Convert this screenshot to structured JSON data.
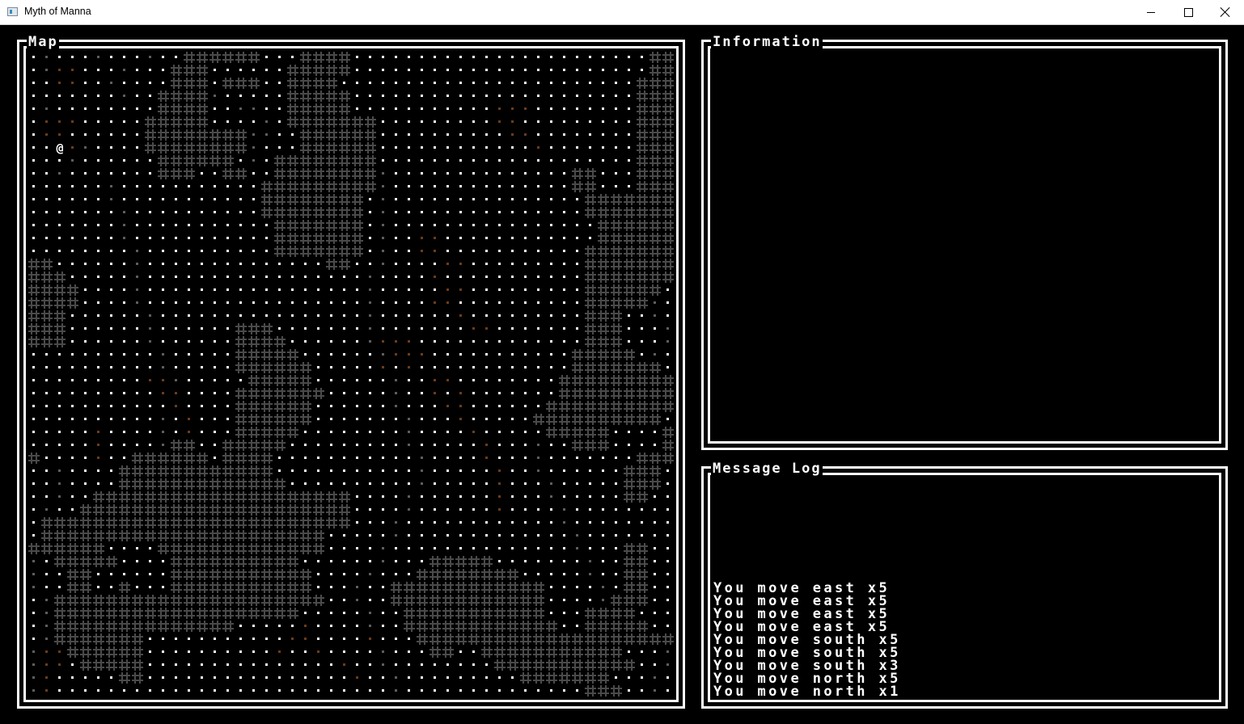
{
  "window": {
    "title": "Myth of Manna",
    "controls": {
      "minimize": "minimize",
      "maximize": "maximize",
      "close": "close"
    }
  },
  "panels": {
    "map_title": "Map",
    "info_title": "Information",
    "log_title": "Message Log"
  },
  "map": {
    "columns": 50,
    "rows": 50,
    "player_glyph": "@",
    "player_position": {
      "col": 2,
      "row": 7
    },
    "legend": {
      "wall": "#",
      "floor_lit": "white",
      "floor_remembered": "gray",
      "floor_dirt": "brown"
    },
    "colors": {
      "wall": "#4a4a4a",
      "floor_lit": "#ffffff",
      "floor_remembered": "#5e5e5e",
      "floor_dirt": "#6b3d1c",
      "player": "#ffffff"
    },
    "wall_runs": [
      [
        [
          12,
          17
        ],
        [
          21,
          24
        ],
        [
          48,
          49
        ]
      ],
      [
        [
          11,
          13
        ],
        [
          20,
          24
        ],
        [
          48,
          49
        ]
      ],
      [
        [
          11,
          13
        ],
        [
          15,
          17
        ],
        [
          20,
          23
        ],
        [
          47,
          49
        ]
      ],
      [
        [
          10,
          13
        ],
        [
          20,
          24
        ],
        [
          47,
          49
        ]
      ],
      [
        [
          10,
          13
        ],
        [
          20,
          24
        ],
        [
          47,
          49
        ]
      ],
      [
        [
          9,
          13
        ],
        [
          20,
          26
        ],
        [
          47,
          49
        ]
      ],
      [
        [
          9,
          16
        ],
        [
          21,
          26
        ],
        [
          47,
          49
        ]
      ],
      [
        [
          9,
          16
        ],
        [
          21,
          26
        ],
        [
          47,
          49
        ]
      ],
      [
        [
          10,
          15
        ],
        [
          19,
          26
        ],
        [
          47,
          49
        ]
      ],
      [
        [
          10,
          12
        ],
        [
          15,
          16
        ],
        [
          19,
          26
        ],
        [
          42,
          43
        ],
        [
          47,
          49
        ]
      ],
      [
        [
          18,
          26
        ],
        [
          42,
          43
        ],
        [
          47,
          49
        ]
      ],
      [
        [
          18,
          25
        ],
        [
          43,
          49
        ]
      ],
      [
        [
          18,
          25
        ],
        [
          43,
          49
        ]
      ],
      [
        [
          19,
          25
        ],
        [
          44,
          49
        ]
      ],
      [
        [
          19,
          25
        ],
        [
          44,
          49
        ]
      ],
      [
        [
          19,
          25
        ],
        [
          43,
          49
        ]
      ],
      [
        [
          0,
          1
        ],
        [
          23,
          24
        ],
        [
          43,
          49
        ]
      ],
      [
        [
          0,
          2
        ],
        [
          43,
          49
        ]
      ],
      [
        [
          0,
          3
        ],
        [
          43,
          48
        ]
      ],
      [
        [
          0,
          3
        ],
        [
          43,
          47
        ]
      ],
      [
        [
          0,
          2
        ],
        [
          43,
          45
        ]
      ],
      [
        [
          0,
          2
        ],
        [
          16,
          18
        ],
        [
          43,
          45
        ]
      ],
      [
        [
          0,
          2
        ],
        [
          16,
          19
        ],
        [
          43,
          45
        ]
      ],
      [
        [
          16,
          20
        ],
        [
          42,
          46
        ]
      ],
      [
        [
          16,
          21
        ],
        [
          42,
          48
        ]
      ],
      [
        [
          17,
          21
        ],
        [
          41,
          49
        ]
      ],
      [
        [
          16,
          22
        ],
        [
          41,
          49
        ]
      ],
      [
        [
          16,
          21
        ],
        [
          40,
          49
        ]
      ],
      [
        [
          16,
          21
        ],
        [
          39,
          48
        ]
      ],
      [
        [
          16,
          20
        ],
        [
          40,
          44
        ],
        [
          49,
          49
        ]
      ],
      [
        [
          11,
          12
        ],
        [
          15,
          19
        ],
        [
          42,
          44
        ],
        [
          49,
          49
        ]
      ],
      [
        [
          0,
          0
        ],
        [
          8,
          13
        ],
        [
          15,
          18
        ],
        [
          47,
          49
        ]
      ],
      [
        [
          7,
          18
        ],
        [
          46,
          48
        ]
      ],
      [
        [
          7,
          19
        ],
        [
          46,
          48
        ]
      ],
      [
        [
          5,
          24
        ],
        [
          46,
          47
        ]
      ],
      [
        [
          4,
          24
        ]
      ],
      [
        [
          1,
          24
        ]
      ],
      [
        [
          1,
          9
        ],
        [
          10,
          22
        ]
      ],
      [
        [
          0,
          5
        ],
        [
          10,
          22
        ],
        [
          46,
          47
        ]
      ],
      [
        [
          2,
          5
        ],
        [
          6,
          6
        ],
        [
          11,
          20
        ],
        [
          31,
          35
        ],
        [
          46,
          47
        ]
      ],
      [
        [
          3,
          4
        ],
        [
          11,
          21
        ],
        [
          30,
          37
        ],
        [
          46,
          47
        ]
      ],
      [
        [
          3,
          4
        ],
        [
          7,
          7
        ],
        [
          11,
          21
        ],
        [
          28,
          39
        ],
        [
          46,
          47
        ]
      ],
      [
        [
          2,
          22
        ],
        [
          28,
          39
        ],
        [
          45,
          47
        ]
      ],
      [
        [
          2,
          20
        ],
        [
          29,
          39
        ],
        [
          43,
          46
        ]
      ],
      [
        [
          2,
          13
        ],
        [
          14,
          15
        ],
        [
          29,
          40
        ],
        [
          43,
          47
        ]
      ],
      [
        [
          2,
          8
        ],
        [
          30,
          49
        ]
      ],
      [
        [
          3,
          8
        ],
        [
          31,
          32
        ],
        [
          35,
          45
        ]
      ],
      [
        [
          4,
          8
        ],
        [
          36,
          46
        ]
      ],
      [
        [
          7,
          8
        ],
        [
          38,
          40
        ],
        [
          41,
          44
        ]
      ],
      [
        [
          43,
          45
        ]
      ]
    ],
    "dirt_cells": [
      [
        1,
        2
      ],
      [
        1,
        3
      ],
      [
        2,
        2
      ],
      [
        2,
        3
      ],
      [
        5,
        1
      ],
      [
        5,
        2
      ],
      [
        5,
        3
      ],
      [
        6,
        1
      ],
      [
        6,
        2
      ],
      [
        7,
        3
      ],
      [
        4,
        36
      ],
      [
        4,
        37
      ],
      [
        4,
        38
      ],
      [
        5,
        36
      ],
      [
        5,
        37
      ],
      [
        6,
        37
      ],
      [
        6,
        38
      ],
      [
        7,
        39
      ],
      [
        14,
        30
      ],
      [
        14,
        31
      ],
      [
        15,
        30
      ],
      [
        15,
        31
      ],
      [
        16,
        32
      ],
      [
        17,
        31
      ],
      [
        16,
        33
      ],
      [
        18,
        32
      ],
      [
        18,
        33
      ],
      [
        19,
        31
      ],
      [
        19,
        32
      ],
      [
        20,
        33
      ],
      [
        21,
        34
      ],
      [
        21,
        35
      ],
      [
        22,
        27
      ],
      [
        22,
        28
      ],
      [
        22,
        29
      ],
      [
        23,
        28
      ],
      [
        23,
        29
      ],
      [
        23,
        30
      ],
      [
        24,
        27
      ],
      [
        24,
        29
      ],
      [
        25,
        31
      ],
      [
        25,
        32
      ],
      [
        26,
        31
      ],
      [
        26,
        33
      ],
      [
        27,
        32
      ],
      [
        27,
        33
      ],
      [
        28,
        33
      ],
      [
        29,
        34
      ],
      [
        30,
        35
      ],
      [
        31,
        35
      ],
      [
        32,
        36
      ],
      [
        33,
        36
      ],
      [
        34,
        36
      ],
      [
        35,
        36
      ],
      [
        25,
        9
      ],
      [
        25,
        10
      ],
      [
        26,
        10
      ],
      [
        26,
        11
      ],
      [
        27,
        11
      ],
      [
        28,
        12
      ],
      [
        29,
        12
      ],
      [
        29,
        5
      ],
      [
        30,
        5
      ],
      [
        31,
        5
      ],
      [
        46,
        1
      ],
      [
        46,
        2
      ],
      [
        47,
        1
      ],
      [
        47,
        2
      ],
      [
        48,
        1
      ],
      [
        49,
        1
      ],
      [
        44,
        4
      ],
      [
        45,
        20
      ],
      [
        45,
        21
      ],
      [
        45,
        26
      ],
      [
        46,
        22
      ],
      [
        47,
        24
      ],
      [
        48,
        25
      ],
      [
        46,
        19
      ],
      [
        43,
        20
      ],
      [
        44,
        21
      ]
    ],
    "gray_cells": [
      [
        0,
        1
      ],
      [
        0,
        5
      ],
      [
        0,
        9
      ],
      [
        1,
        1
      ],
      [
        1,
        7
      ],
      [
        2,
        6
      ],
      [
        2,
        16
      ],
      [
        3,
        7
      ],
      [
        3,
        14
      ],
      [
        4,
        1
      ],
      [
        4,
        16
      ],
      [
        4,
        17
      ],
      [
        5,
        18
      ],
      [
        6,
        17
      ],
      [
        6,
        18
      ],
      [
        7,
        4
      ],
      [
        7,
        17
      ],
      [
        8,
        3
      ],
      [
        8,
        17
      ],
      [
        9,
        2
      ],
      [
        9,
        27
      ],
      [
        10,
        27
      ],
      [
        11,
        27
      ],
      [
        12,
        27
      ],
      [
        13,
        27
      ],
      [
        14,
        27
      ],
      [
        15,
        27
      ],
      [
        16,
        27
      ],
      [
        17,
        26
      ],
      [
        18,
        26
      ],
      [
        19,
        26
      ],
      [
        20,
        26
      ],
      [
        21,
        26
      ],
      [
        22,
        26
      ],
      [
        23,
        27
      ],
      [
        24,
        27
      ],
      [
        25,
        28
      ],
      [
        26,
        28
      ],
      [
        27,
        28
      ],
      [
        28,
        29
      ],
      [
        29,
        29
      ],
      [
        30,
        29
      ],
      [
        31,
        30
      ],
      [
        32,
        30
      ],
      [
        33,
        30
      ],
      [
        34,
        29
      ],
      [
        35,
        29
      ],
      [
        36,
        28
      ],
      [
        37,
        28
      ],
      [
        38,
        27
      ],
      [
        39,
        27
      ],
      [
        40,
        26
      ],
      [
        41,
        25
      ],
      [
        42,
        25
      ],
      [
        43,
        26
      ],
      [
        44,
        26
      ],
      [
        45,
        26
      ],
      [
        46,
        27
      ],
      [
        47,
        27
      ],
      [
        48,
        28
      ],
      [
        49,
        28
      ],
      [
        30,
        39
      ],
      [
        31,
        39
      ],
      [
        32,
        39
      ],
      [
        33,
        40
      ],
      [
        34,
        40
      ],
      [
        35,
        41
      ],
      [
        36,
        41
      ],
      [
        37,
        42
      ],
      [
        38,
        42
      ],
      [
        39,
        43
      ],
      [
        40,
        43
      ],
      [
        41,
        44
      ],
      [
        42,
        44
      ],
      [
        43,
        45
      ],
      [
        44,
        45
      ],
      [
        45,
        48
      ],
      [
        46,
        49
      ],
      [
        47,
        49
      ],
      [
        48,
        48
      ],
      [
        49,
        48
      ],
      [
        10,
        6
      ],
      [
        11,
        6
      ],
      [
        12,
        7
      ],
      [
        13,
        7
      ],
      [
        14,
        7
      ],
      [
        15,
        8
      ],
      [
        16,
        8
      ],
      [
        17,
        8
      ],
      [
        18,
        8
      ],
      [
        19,
        8
      ],
      [
        20,
        9
      ],
      [
        21,
        9
      ],
      [
        22,
        9
      ],
      [
        23,
        10
      ],
      [
        24,
        10
      ],
      [
        25,
        11
      ],
      [
        26,
        11
      ],
      [
        27,
        11
      ],
      [
        28,
        10
      ],
      [
        29,
        10
      ],
      [
        30,
        10
      ],
      [
        31,
        10
      ],
      [
        32,
        2
      ],
      [
        33,
        2
      ],
      [
        34,
        2
      ],
      [
        35,
        1
      ],
      [
        36,
        1
      ],
      [
        37,
        1
      ],
      [
        38,
        1
      ],
      [
        39,
        0
      ],
      [
        40,
        0
      ],
      [
        41,
        0
      ],
      [
        42,
        1
      ],
      [
        43,
        1
      ],
      [
        44,
        1
      ],
      [
        45,
        1
      ],
      [
        46,
        0
      ],
      [
        47,
        0
      ],
      [
        48,
        0
      ],
      [
        49,
        0
      ],
      [
        12,
        45
      ],
      [
        13,
        45
      ],
      [
        14,
        46
      ],
      [
        15,
        46
      ],
      [
        16,
        47
      ],
      [
        17,
        48
      ],
      [
        18,
        48
      ],
      [
        19,
        48
      ],
      [
        20,
        48
      ],
      [
        21,
        49
      ],
      [
        22,
        49
      ],
      [
        23,
        48
      ],
      [
        24,
        48
      ],
      [
        25,
        47
      ],
      [
        26,
        47
      ],
      [
        27,
        47
      ]
    ]
  },
  "information": {
    "lines": []
  },
  "message_log": {
    "lines": [
      "You move east x5",
      "You move east x5",
      "You move east x5",
      "You move east x5",
      "You move south x5",
      "You move south x5",
      "You move south x3",
      "You move north x5",
      "You move north x1"
    ]
  }
}
